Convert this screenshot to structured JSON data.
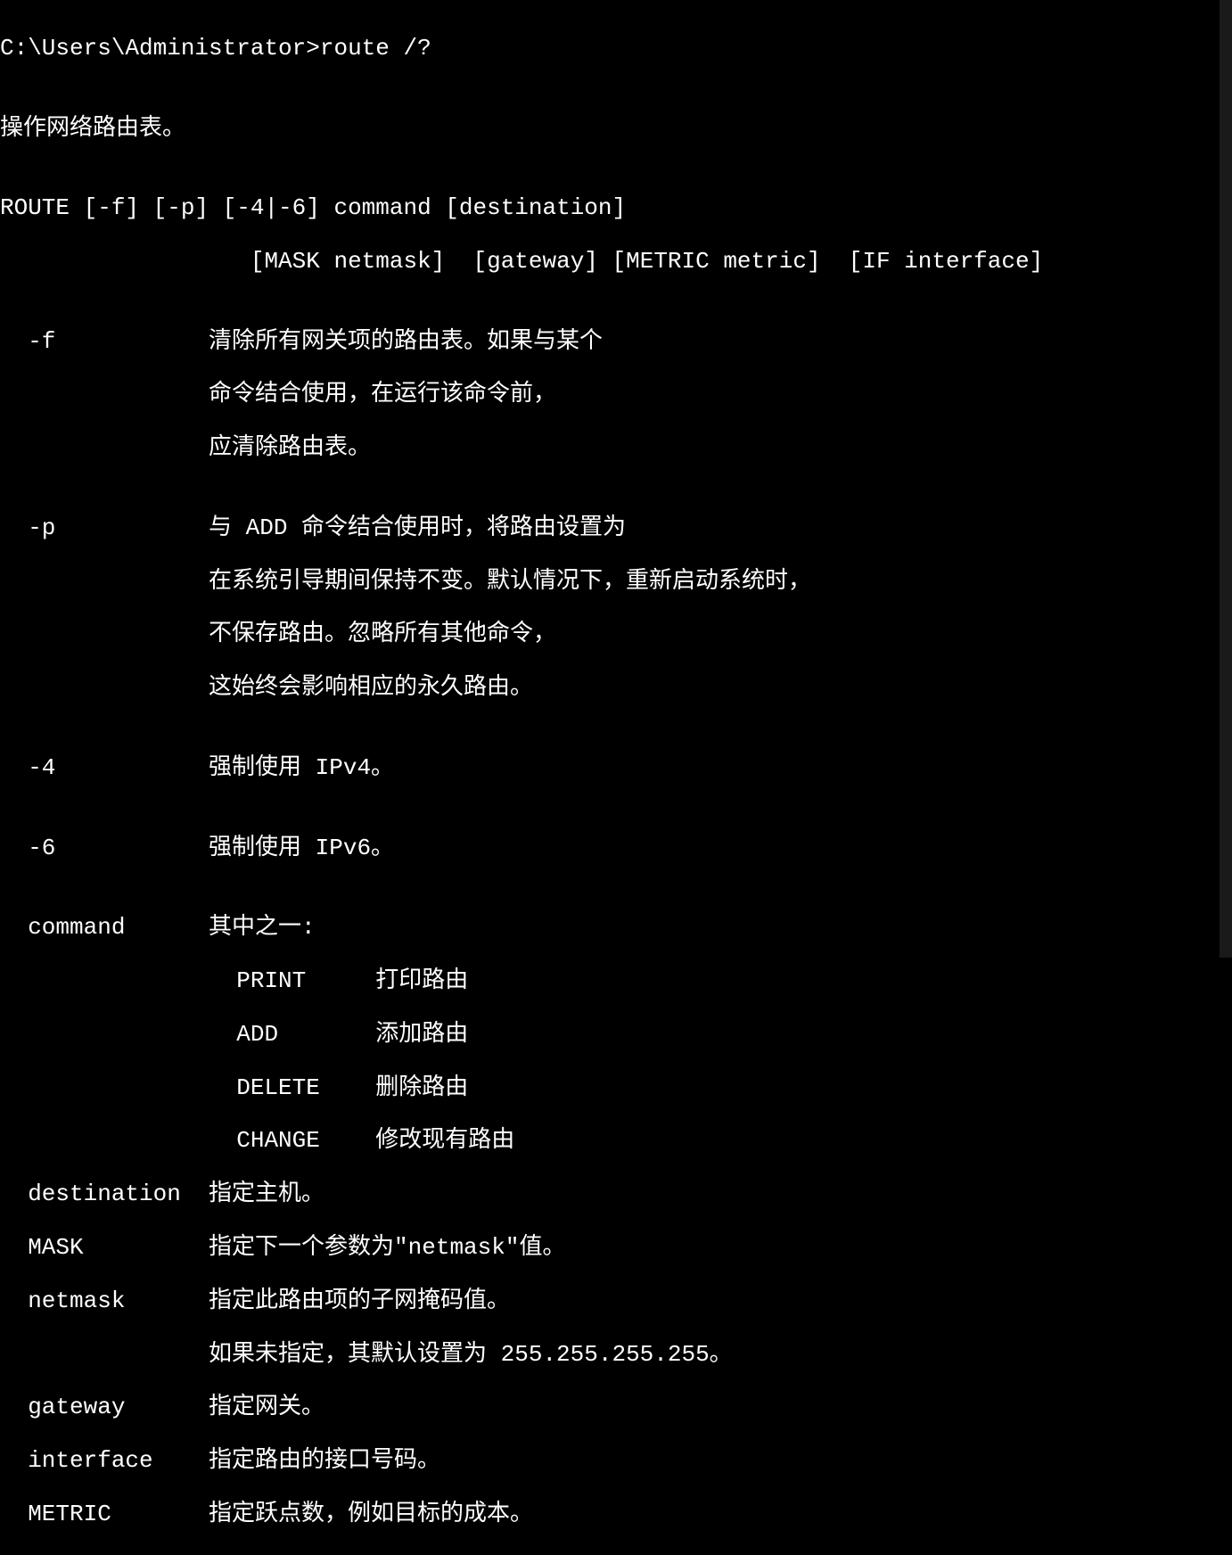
{
  "prompt_line": "C:\\Users\\Administrator>route /?",
  "blank": "",
  "desc": "操作网络路由表。",
  "syntax1": "ROUTE [-f] [-p] [-4|-6] command [destination]",
  "syntax2": "                  [MASK netmask]  [gateway] [METRIC metric]  [IF interface]",
  "opt_f1": "  -f           清除所有网关项的路由表。如果与某个",
  "opt_f2": "               命令结合使用，在运行该命令前，",
  "opt_f3": "               应清除路由表。",
  "opt_p1": "  -p           与 ADD 命令结合使用时，将路由设置为",
  "opt_p2": "               在系统引导期间保持不变。默认情况下，重新启动系统时，",
  "opt_p3": "               不保存路由。忽略所有其他命令，",
  "opt_p4": "               这始终会影响相应的永久路由。",
  "opt_4": "  -4           强制使用 IPv4。",
  "opt_6": "  -6           强制使用 IPv6。",
  "cmd1": "  command      其中之一:",
  "cmd2": "                 PRINT     打印路由",
  "cmd3": "                 ADD       添加路由",
  "cmd4": "                 DELETE    删除路由",
  "cmd5": "                 CHANGE    修改现有路由",
  "dest": "  destination  指定主机。",
  "mask": "  MASK         指定下一个参数为\"netmask\"值。",
  "netm1": "  netmask      指定此路由项的子网掩码值。",
  "netm2": "               如果未指定，其默认设置为 255.255.255.255。",
  "gw": "  gateway      指定网关。",
  "if": "  interface    指定路由的接口号码。",
  "metric": "  METRIC       指定跃点数，例如目标的成本。"
}
